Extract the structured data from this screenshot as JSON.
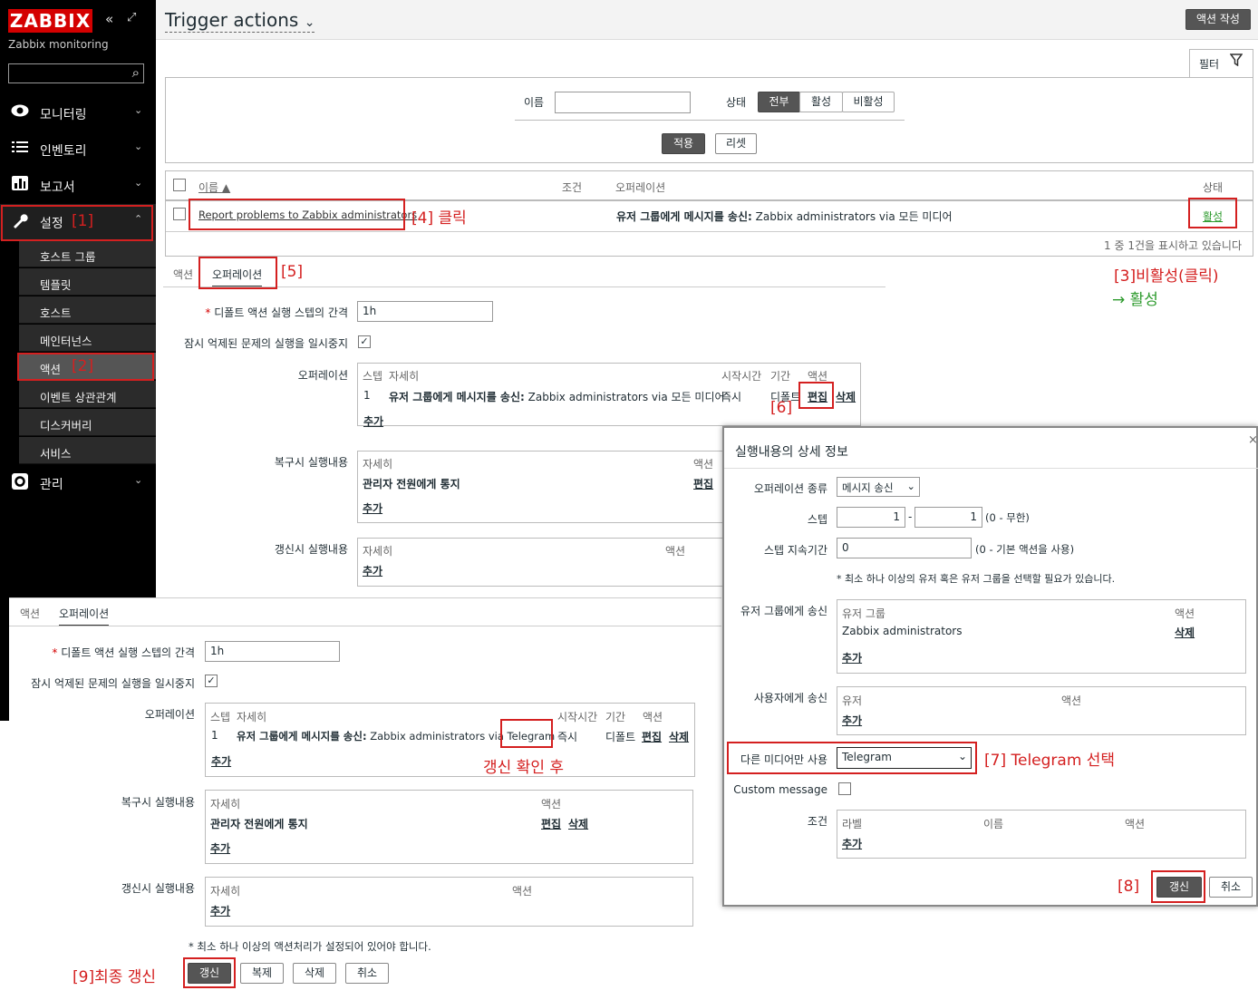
{
  "sidebar": {
    "logo": "ZABBIX",
    "subtitle": "Zabbix monitoring",
    "icons": {
      "collapse": "«",
      "expand": "⤢",
      "search": "⌕"
    },
    "menu": [
      {
        "label": "모니터링",
        "icon": "eye-icon"
      },
      {
        "label": "인벤토리",
        "icon": "list-icon"
      },
      {
        "label": "보고서",
        "icon": "chart-icon"
      },
      {
        "label": "설정",
        "icon": "wrench-icon"
      },
      {
        "label": "관리",
        "icon": "gear-icon"
      }
    ],
    "submenu": [
      "호스트 그룹",
      "템플릿",
      "호스트",
      "메인터넌스",
      "액션",
      "이벤트 상관관계",
      "디스커버리",
      "서비스"
    ]
  },
  "header": {
    "title": "Trigger actions",
    "create_button": "액션 작성"
  },
  "filter": {
    "tab_label": "필터",
    "name_label": "이름",
    "status_label": "상태",
    "status_options": [
      "전부",
      "활성",
      "비활성"
    ],
    "apply": "적용",
    "reset": "리셋"
  },
  "table": {
    "headers": [
      "이름 ▲",
      "조건",
      "오퍼레이션",
      "상태"
    ],
    "row": {
      "name": "Report problems to Zabbix administrators",
      "operation_bold": "유저 그룹에게 메시지를 송신:",
      "operation_rest": " Zabbix administrators via 모든 미디어",
      "status": "활성"
    },
    "footer": "1 중 1건을 표시하고 있습니다"
  },
  "form1": {
    "tabs": [
      "액션",
      "오퍼레이션"
    ],
    "step_duration_label": "디폴트 액션 실행 스텝의 간격",
    "step_duration_value": "1h",
    "pause_label": "잠시 억제된 문제의 실행을 일시중지",
    "ops_label": "오퍼레이션",
    "ops_headers": [
      "스텝",
      "자세히",
      "시작시간",
      "기간",
      "액션"
    ],
    "ops_row": {
      "step": "1",
      "detail_bold": "유저 그룹에게 메시지를 송신:",
      "detail_rest": " Zabbix administrators via 모든 미디어",
      "start": "즉시",
      "duration": "디폴트",
      "edit": "편집",
      "delete": "삭제"
    },
    "add": "추가",
    "recovery_label": "복구시 실행내용",
    "recovery_headers": [
      "자세히",
      "액션"
    ],
    "recovery_row": "관리자 전원에게 통지",
    "edit": "편집",
    "update_label": "갱신시 실행내용",
    "update_headers": [
      "자세히",
      "액션"
    ]
  },
  "form2": {
    "tabs": [
      "액션",
      "오퍼레이션"
    ],
    "step_duration_label": "디폴트 액션 실행 스텝의 간격",
    "step_duration_value": "1h",
    "pause_label": "잠시 억제된 문제의 실행을 일시중지",
    "ops_label": "오퍼레이션",
    "ops_headers": [
      "스텝",
      "자세히",
      "시작시간",
      "기간",
      "액션"
    ],
    "ops_row": {
      "step": "1",
      "detail_bold": "유저 그룹에게 메시지를 송신:",
      "detail_rest": " Zabbix administrators via ",
      "media": "Telegram",
      "start": "즉시",
      "duration": "디폴트",
      "edit": "편집",
      "delete": "삭제"
    },
    "add": "추가",
    "recovery_label": "복구시 실행내용",
    "recovery_headers": [
      "자세히",
      "액션"
    ],
    "recovery_row": "관리자 전원에게 통지",
    "edit": "편집",
    "delete": "삭제",
    "update_label": "갱신시 실행내용",
    "update_headers": [
      "자세히",
      "액션"
    ],
    "note": "* 최소 하나 이상의 액션처리가 설정되어 있어야 합니다.",
    "buttons": [
      "갱신",
      "복제",
      "삭제",
      "취소"
    ]
  },
  "dialog": {
    "title": "실행내용의 상세 정보",
    "close": "×",
    "op_type_label": "오퍼레이션 종류",
    "op_type_value": "메시지 송신",
    "steps_label": "스텝",
    "step_from": "1",
    "step_to": "1",
    "step_hint": "(0 - 무한)",
    "step_duration_label": "스텝 지속기간",
    "step_duration_value": "0",
    "step_duration_hint": "(0 - 기본 액션을 사용)",
    "note": "* 최소 하나 이상의 유저 혹은 유저 그룹을 선택할 필요가 있습니다.",
    "send_groups_label": "유저 그룹에게 송신",
    "groups_headers": [
      "유저 그룹",
      "액션"
    ],
    "group_row": "Zabbix administrators",
    "delete": "삭제",
    "add": "추가",
    "send_users_label": "사용자에게 송신",
    "users_headers": [
      "유저",
      "액션"
    ],
    "media_label": "다른 미디어만 사용",
    "media_value": "Telegram",
    "custom_msg_label": "Custom message",
    "cond_label": "조건",
    "cond_headers": [
      "라벨",
      "이름",
      "액션"
    ],
    "update": "갱신",
    "cancel": "취소"
  },
  "annotations": {
    "a1": "[1]",
    "a2": "[2]",
    "a3_1": "[3]비활성(클릭)",
    "a3_2": "→ 활성",
    "a4": "[4] 클릭",
    "a5": "[5]",
    "a6": "[6]",
    "a7": "[7] Telegram 선택",
    "a8": "[8]",
    "a9": "[9]최종 갱신",
    "after": "갱신 확인 후"
  }
}
